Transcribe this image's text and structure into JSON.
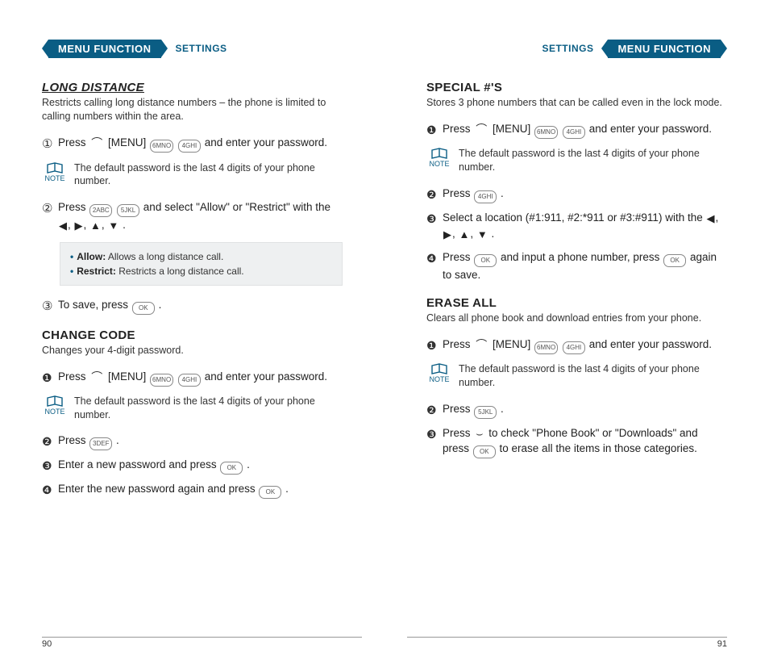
{
  "header": {
    "tab": "MENU FUNCTION",
    "sub": "SETTINGS"
  },
  "noteLabel": "NOTE",
  "noteDefaultPassword": "The default password is the last 4 digits of your phone number.",
  "keys": {
    "menu": "[MENU]",
    "ok": "OK",
    "k2": "2ABC",
    "k3": "3DEF",
    "k4": "4GHI",
    "k5": "5JKL",
    "k6": "6MNO"
  },
  "left": {
    "longDistance": {
      "title": "LONG DISTANCE",
      "desc": "Restricts calling long distance numbers – the phone is limited to calling numbers within the area.",
      "step1a": "Press ",
      "step1b": " and enter your password.",
      "step2a": "Press ",
      "step2b": " and select \"Allow\" or \"Restrict\" with the ",
      "step2c": ".",
      "box": {
        "allowLabel": "Allow:",
        "allowText": " Allows a long distance call.",
        "restrictLabel": "Restrict:",
        "restrictText": " Restricts a long distance call."
      },
      "step3a": "To save, press ",
      "step3b": "."
    },
    "changeCode": {
      "title": "CHANGE CODE",
      "desc": "Changes your 4-digit password.",
      "step1a": "Press ",
      "step1b": " and enter your password.",
      "step2a": "Press ",
      "step2b": ".",
      "step3a": "Enter a new password and press ",
      "step3b": ".",
      "step4a": "Enter the new password again and press ",
      "step4b": "."
    },
    "pageNum": "90"
  },
  "right": {
    "special": {
      "title": "SPECIAL #'S",
      "desc": "Stores 3 phone numbers that can be called even in the lock mode.",
      "step1a": "Press ",
      "step1b": " and enter your password.",
      "step2a": "Press ",
      "step2b": ".",
      "step3a": "Select a location (#1:911, #2:*911 or #3:#911) with the ",
      "step3b": ".",
      "step4a": "Press ",
      "step4b": " and input a phone number, press ",
      "step4c": " again to save."
    },
    "eraseAll": {
      "title": "ERASE ALL",
      "desc": "Clears all phone book and download entries from your phone.",
      "step1a": "Press ",
      "step1b": " and enter your password.",
      "step2a": "Press ",
      "step2b": ".",
      "step3a": "Press ",
      "step3b": " to check \"Phone Book\" or \"Downloads\" and press ",
      "step3c": " to erase all the items in those categories."
    },
    "pageNum": "91"
  }
}
